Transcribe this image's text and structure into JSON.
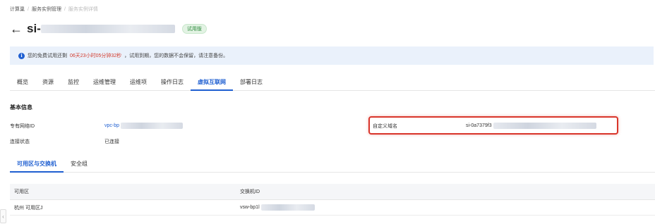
{
  "breadcrumb": {
    "items": [
      "计算巢",
      "服务实例管理",
      "服务实例详情"
    ],
    "separator": "/"
  },
  "header": {
    "back_icon": "arrow-left-icon",
    "title_prefix": "si-",
    "badge": "试用版"
  },
  "notice": {
    "icon": "info-icon",
    "prefix": "您的免费试用还剩",
    "countdown": "06天23小时05分钟32秒",
    "suffix": "，试用到期，您的数据不会保留，请注意备份。"
  },
  "tabs": [
    {
      "label": "概览",
      "active": false
    },
    {
      "label": "资源",
      "active": false
    },
    {
      "label": "监控",
      "active": false
    },
    {
      "label": "运维管理",
      "active": false
    },
    {
      "label": "运维项",
      "active": false
    },
    {
      "label": "操作日志",
      "active": false
    },
    {
      "label": "虚拟互联网",
      "active": true
    },
    {
      "label": "部署日志",
      "active": false
    }
  ],
  "basic_info": {
    "title": "基本信息",
    "vpc_label": "专有网络ID",
    "vpc_value_prefix": "vpc-bp",
    "status_label": "连接状态",
    "status_value": "已连接",
    "domain_label": "自定义域名",
    "domain_value_prefix": "si-0a7379f3"
  },
  "subtabs": [
    {
      "label": "可用区与交换机",
      "active": true
    },
    {
      "label": "安全组",
      "active": false
    }
  ],
  "table": {
    "headers": [
      "可用区",
      "交换机ID"
    ],
    "rows": [
      {
        "zone": "杭州 可用区J",
        "vswitch_prefix": "vsw-bp1l"
      }
    ]
  },
  "colors": {
    "accent": "#1f5fd1",
    "countdown": "#d23a2c",
    "highlight": "#d9352b",
    "badge_text": "#2e8b3d"
  }
}
